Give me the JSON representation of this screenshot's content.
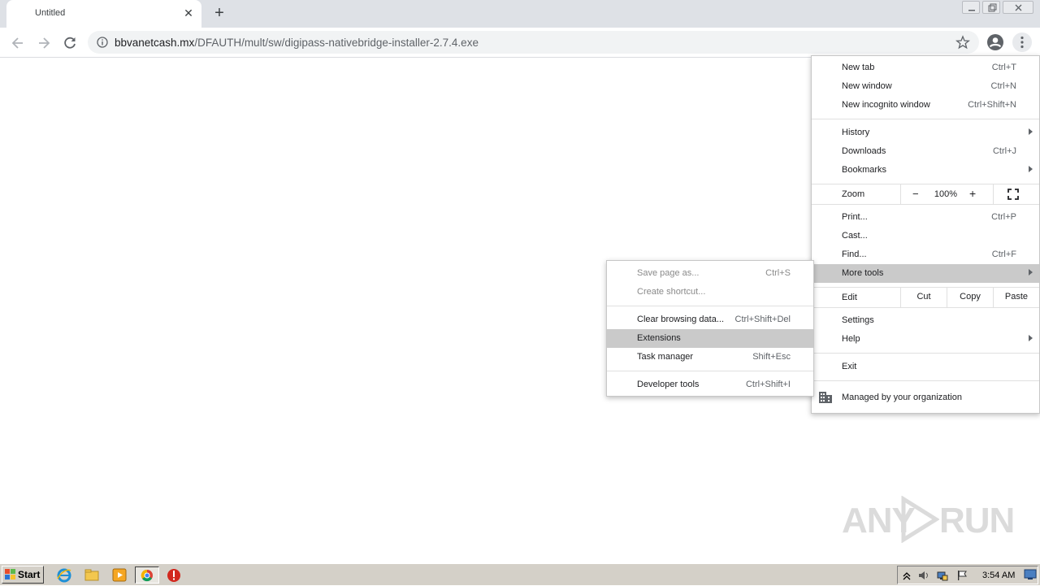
{
  "browser": {
    "tab_title": "Untitled",
    "url_host": "bbvanetcash.mx",
    "url_path": "/DFAUTH/mult/sw/digipass-nativebridge-installer-2.7.4.exe"
  },
  "main_menu": {
    "new_tab": {
      "label": "New tab",
      "shortcut": "Ctrl+T"
    },
    "new_window": {
      "label": "New window",
      "shortcut": "Ctrl+N"
    },
    "new_incognito": {
      "label": "New incognito window",
      "shortcut": "Ctrl+Shift+N"
    },
    "history": {
      "label": "History"
    },
    "downloads": {
      "label": "Downloads",
      "shortcut": "Ctrl+J"
    },
    "bookmarks": {
      "label": "Bookmarks"
    },
    "zoom": {
      "label": "Zoom",
      "minus": "−",
      "value": "100%",
      "plus": "+"
    },
    "print": {
      "label": "Print...",
      "shortcut": "Ctrl+P"
    },
    "cast": {
      "label": "Cast..."
    },
    "find": {
      "label": "Find...",
      "shortcut": "Ctrl+F"
    },
    "more_tools": {
      "label": "More tools"
    },
    "edit": {
      "label": "Edit",
      "cut": "Cut",
      "copy": "Copy",
      "paste": "Paste"
    },
    "settings": {
      "label": "Settings"
    },
    "help": {
      "label": "Help"
    },
    "exit": {
      "label": "Exit"
    },
    "managed": {
      "label": "Managed by your organization"
    }
  },
  "more_tools_menu": {
    "save_page": {
      "label": "Save page as...",
      "shortcut": "Ctrl+S"
    },
    "create_shortcut": {
      "label": "Create shortcut..."
    },
    "clear_data": {
      "label": "Clear browsing data...",
      "shortcut": "Ctrl+Shift+Del"
    },
    "extensions": {
      "label": "Extensions"
    },
    "task_manager": {
      "label": "Task manager",
      "shortcut": "Shift+Esc"
    },
    "dev_tools": {
      "label": "Developer tools",
      "shortcut": "Ctrl+Shift+I"
    }
  },
  "watermark": {
    "left": "ANY",
    "right": "RUN"
  },
  "taskbar": {
    "start_label": "Start",
    "clock": "3:54 AM",
    "icons": [
      "ie-icon",
      "folder-icon",
      "media-player-icon",
      "chrome-icon",
      "stop-icon"
    ]
  },
  "colors": {
    "tab_strip": "#dee1e6",
    "menu_highlight": "#cacaca",
    "taskbar": "#d4d0c8"
  }
}
